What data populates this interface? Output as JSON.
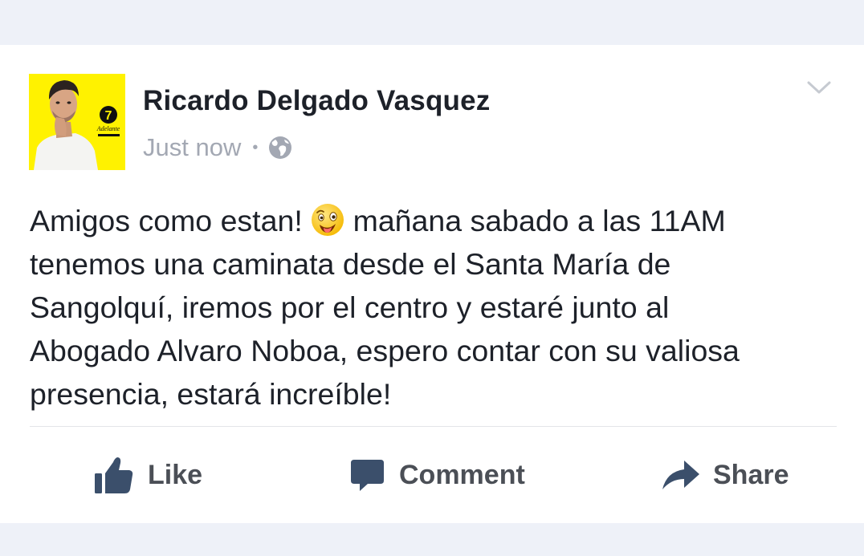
{
  "post": {
    "author": "Ricardo Delgado Vasquez",
    "timestamp": "Just now",
    "separator": "•",
    "privacy_icon": "globe-icon",
    "menu_icon": "chevron-down-icon",
    "avatar": {
      "badge_number": "7",
      "badge_text": "Adelante",
      "background_color": "#fff200"
    },
    "text_before_emoji": "Amigos como estan! ",
    "emoji": "smiley-tongue-face",
    "text_after_emoji": " mañana sabado a las 11AM\ntenemos una caminata desde el Santa María de\nSangolquí, iremos por el centro y estaré junto al\nAbogado Alvaro Noboa, espero contar con su valiosa\npresencia, estará increíble!"
  },
  "actions": {
    "like_label": "Like",
    "like_icon": "thumbs-up-icon",
    "comment_label": "Comment",
    "comment_icon": "speech-bubble-icon",
    "share_label": "Share",
    "share_icon": "share-arrow-icon"
  },
  "colors": {
    "background": "#eef1f8",
    "card": "#ffffff",
    "text_primary": "#1d2129",
    "text_secondary": "#a3a8b3",
    "action_text": "#4b4f56",
    "action_icon": "#3b4f6b"
  }
}
